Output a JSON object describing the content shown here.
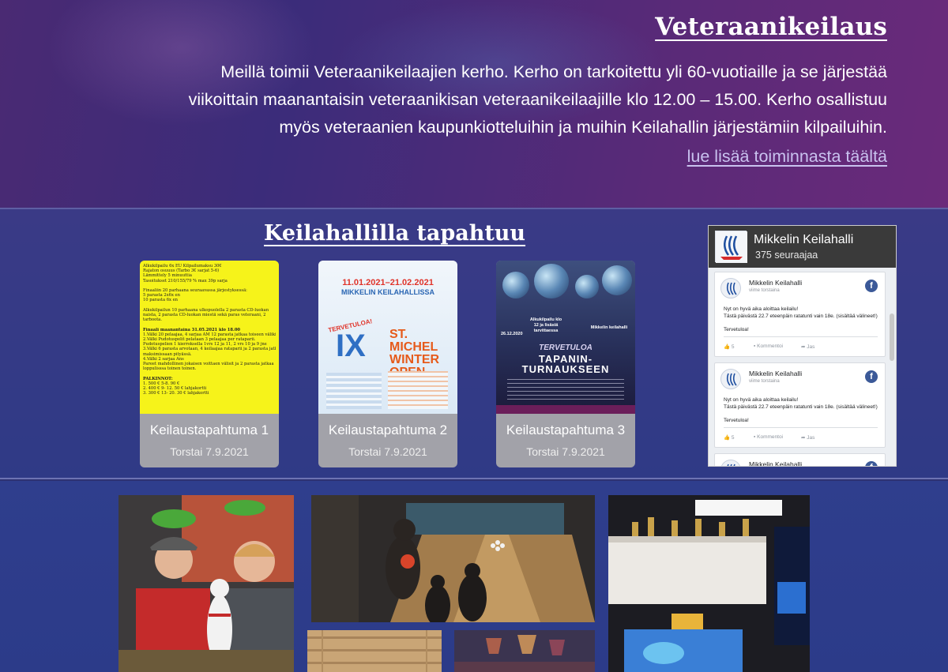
{
  "veteran": {
    "title": "Veteraanikeilaus",
    "text_lines": [
      "Meillä toimii Veteraanikeilaajien kerho. Kerho on tarkoitettu yli 60-vuotiaille ja se järjestää",
      "viikoittain maanantaisin veteraanikisan veteraanikeilaajille klo 12.00 – 15.00. Kerho osallistuu",
      "myös veteraanien kaupunkiotteluihin ja muihin Keilahallin järjestämiin kilpailuihin."
    ],
    "link": "lue lisää toiminnasta täältä"
  },
  "events": {
    "title": "Keilahallilla tapahtuu",
    "cards": [
      {
        "title": "Keilaustapahtuma 1",
        "date": "Torstai 7.9.2021"
      },
      {
        "title": "Keilaustapahtuma 2",
        "date": "Torstai 7.9.2021"
      },
      {
        "title": "Keilaustapahtuma 3",
        "date": "Torstai 7.9.2021"
      }
    ],
    "poster1": {
      "lines": [
        "Alkukilpailu 6x EU        Kilpailumaksu 30€",
        "Rajaton osuuus                (Tarbo 3€ sarjat 5-6)",
        "Lämmittely 5 minuuttia",
        "Tasoitukset 210/155/79 % max 39p sarja",
        "",
        "Finaaliin 20 parhaana seuraavassa järjestyksessä:",
        " 5 parasta 2x6x en",
        "10 parasta 6x en",
        "",
        "Alkukilpailun 10 parhaana ulkopuolella 2 parasta CD-luokan",
        "naista, 2 parasta CD-luokan miestä sekä paras veteraani, 2",
        "tarboota.",
        "",
        "Finaali maanantaina 31.05.2021 klo 18.00",
        "1.Välki 20 pelaajaa, 4 sarjaa AM 12 parasta jatkaa toiseen välikierrosn",
        "2.Välki Pudotuspelit pelataan 3 pelaajaa per rataparii.",
        "Pudotuspelien 1 kierroksella 1vrs 12 ja 11,  2 vrs 10 ja 9 jne",
        "3.Välki 6 parasta arvotaan, 4 keilaajaa rataparii ja 2 parasta jatkaa",
        "maksimissaan pityässä.",
        "4.Välki 2 sarjaa Ans",
        "Pareet mahdollinen jokaisen voittaen välisit ja 2 parasta jatkaa",
        "loppulisssa toinen toinen.",
        "",
        "PALKINNOT:",
        "   1. 500 €                       5-8. 90 €",
        "   2. 400 €                       9- 12. 50 € lahjakortti",
        "   3. 300 €                       13- 20. 30 € lahjakortti"
      ]
    },
    "poster2": {
      "dates": "11.01.2021–21.02.2021",
      "subtitle": "MIKKELIN KEILAHALLISSA",
      "welcome": "TERVETULOA!",
      "big": "IX",
      "name": "ST. MICHEL WINTER OPEN"
    },
    "poster3": {
      "date": "26.12.2020",
      "mid_left": "Alkukilpailu klo 12 ja lisäsiä tarvittaessa",
      "mid_right": "Mikkelin keilahalli",
      "welcome": "TERVETULOA",
      "title": "TAPANIN-TURNAUKSEEN"
    }
  },
  "facebook": {
    "page_name": "Mikkelin Keilahalli",
    "followers": "375 seuraajaa",
    "posts": [
      {
        "name": "Mikkelin Keilahalli",
        "time": "viime torstaina",
        "text": "Nyt on hyvä aika aloittaa keilailu!\nTästä päivästä 22.7 eteenpäin ratatunti vain 18e. (sisältää välineet!)",
        "extra": "Tervetuloa!",
        "likes": "5",
        "comment": "Kommentoi",
        "share": "Jas"
      },
      {
        "name": "Mikkelin Keilahalli",
        "time": "viime torstaina",
        "text": "Nyt on hyvä aika aloittaa keilailu!\nTästä päivästä 22.7 eteenpäin ratatunti vain 18e. (sisältää välineet!)",
        "extra": "Tervetuloa!",
        "likes": "5",
        "comment": "Kommentoi",
        "share": "Jas"
      },
      {
        "name": "Mikkelin Keilahalli",
        "time": "",
        "text": "",
        "extra": "",
        "likes": "",
        "comment": "",
        "share": ""
      }
    ]
  }
}
